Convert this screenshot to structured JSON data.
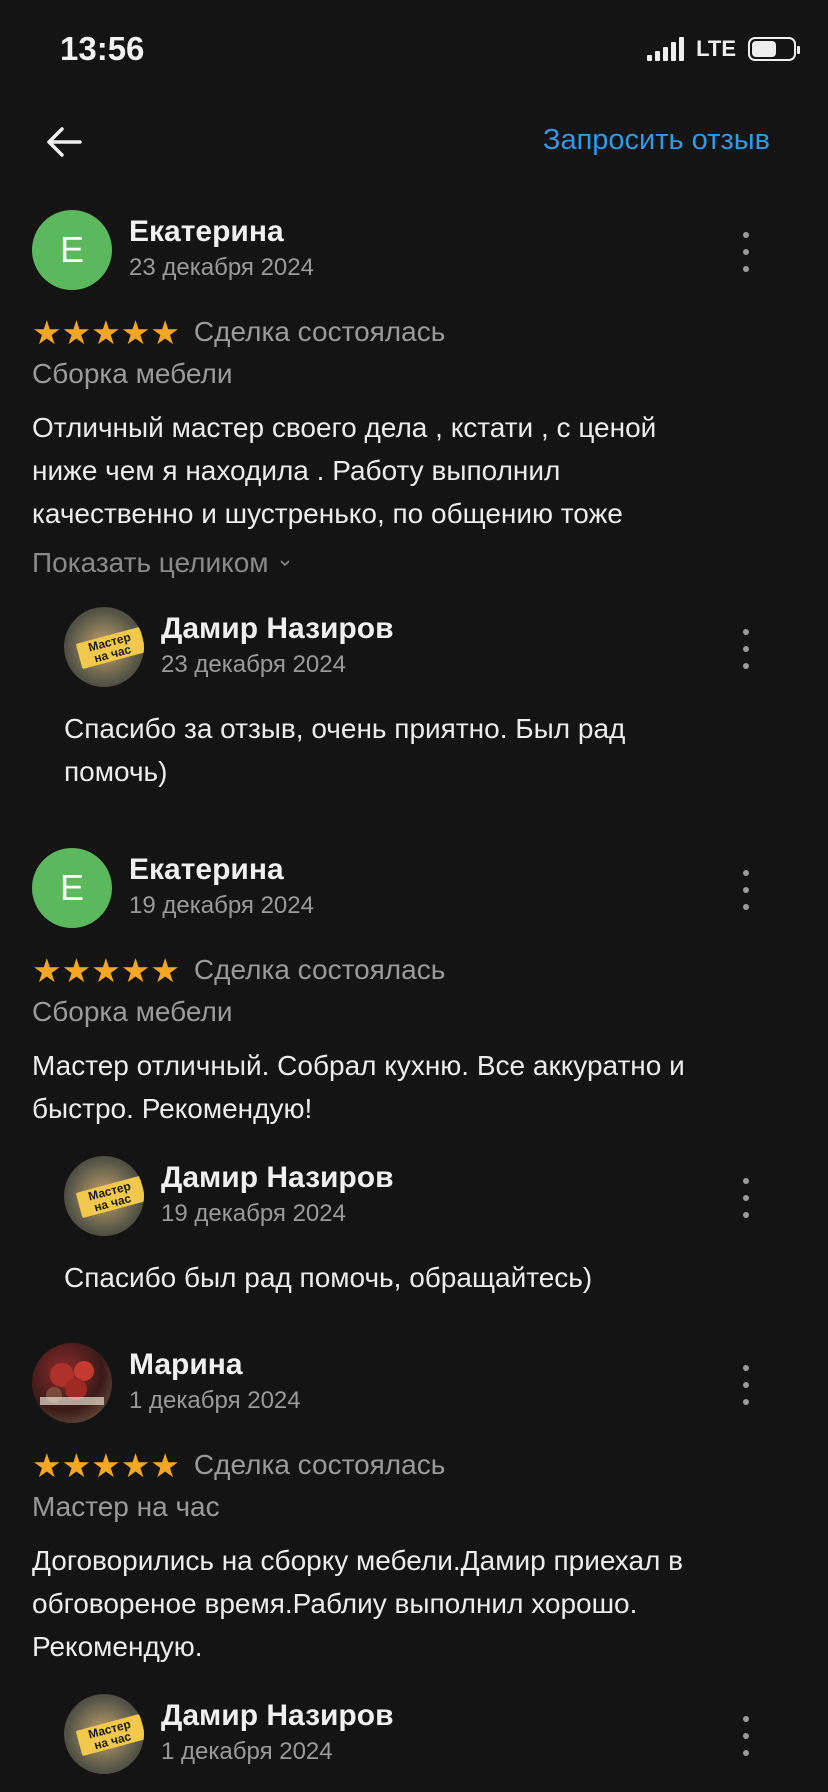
{
  "status": {
    "time": "13:56",
    "network": "LTE"
  },
  "header": {
    "request_label": "Запросить отзыв"
  },
  "reviews": [
    {
      "initial": "Е",
      "name": "Екатерина",
      "date": "23 декабря 2024",
      "stars": "★★★★★",
      "rating": 5,
      "deal": "Сделка состоялась",
      "category": "Сборка мебели",
      "text": "Отличный мастер своего дела , кстати , с ценой\nниже чем я находила . Работу выполнил\nкачественно и шустренько, по общению тоже",
      "show_more": "Показать целиком",
      "reply": {
        "logo": "Мастер на час",
        "name": "Дамир  Назиров",
        "date": "23 декабря 2024",
        "text": "Спасибо за отзыв, очень приятно. Был рад\nпомочь)"
      }
    },
    {
      "initial": "Е",
      "name": "Екатерина",
      "date": "19 декабря 2024",
      "stars": "★★★★★",
      "rating": 5,
      "deal": "Сделка состоялась",
      "category": "Сборка мебели",
      "text": "Мастер отличный. Собрал кухню. Все аккуратно и\nбыстро. Рекомендую!",
      "reply": {
        "logo": "Мастер на час",
        "name": "Дамир  Назиров",
        "date": "19 декабря 2024",
        "text": "Спасибо был рад помочь, обращайтесь)"
      }
    },
    {
      "name": "Марина",
      "date": "1 декабря 2024",
      "stars": "★★★★★",
      "rating": 5,
      "deal": "Сделка состоялась",
      "category": "Мастер на час",
      "text": "Договорились на сборку мебели.Дамир приехал в\nобговореное время.Раблиу выполнил хорошо.\nРекомендую.",
      "reply": {
        "logo": "Мастер на час",
        "name": "Дамир  Назиров",
        "date": "1 декабря 2024"
      }
    }
  ]
}
